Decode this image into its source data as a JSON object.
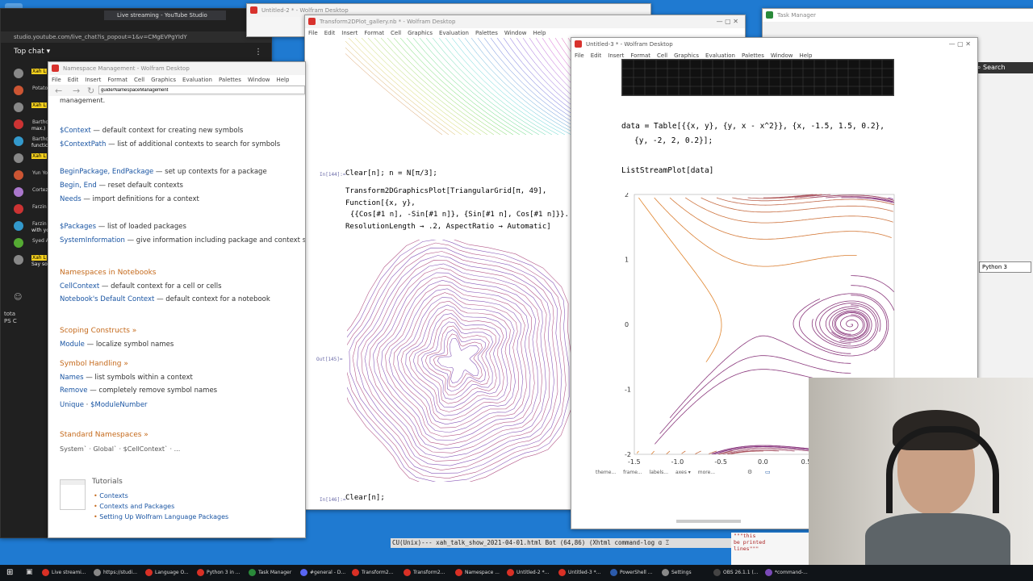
{
  "desktop": {
    "accent": "#1f7ad1"
  },
  "youtube": {
    "tab_title": "Live streaming - YouTube Studio",
    "url": "https://studio.youtube.com/live_chat?is_popout=1&v=CMgEVPgYIdY",
    "url_short": "studio.youtube.com/live_chat?is_popout=1&v=CMgEVPgYIdY",
    "top_chat": "Top chat",
    "chat": [
      {
        "name": "Xah L",
        "text": ""
      },
      {
        "name": "Potato",
        "text": ""
      },
      {
        "name": "Xah L",
        "text": ""
      },
      {
        "name": "Bartho",
        "text": "max.)"
      },
      {
        "name": "Bartho",
        "text": "functic"
      },
      {
        "name": "Xah L",
        "text": ""
      },
      {
        "name": "Yun Yo",
        "text": ""
      },
      {
        "name": "Cortez",
        "text": ""
      },
      {
        "name": "Farzin",
        "text": ""
      },
      {
        "name": "Farzin",
        "text": "with yc previo"
      },
      {
        "name": "Syed A",
        "text": ""
      },
      {
        "name": "Xah L",
        "text": "Say so"
      }
    ],
    "footer_text": "tota",
    "ps": "PS C"
  },
  "doc_window": {
    "title": "Namespace Management - Wolfram Desktop",
    "menu": [
      "File",
      "Edit",
      "Insert",
      "Format",
      "Cell",
      "Graphics",
      "Evaluation",
      "Palettes",
      "Window",
      "Help"
    ],
    "search_value": "guide/NamespaceManagement",
    "intro": "management.",
    "items": [
      {
        "link": "$Context",
        "desc": " — default context for creating new symbols"
      },
      {
        "link": "$ContextPath",
        "desc": " — list of additional contexts to search for symbols"
      },
      {
        "link": "BeginPackage, EndPackage",
        "desc": " — set up contexts for a package"
      },
      {
        "link": "Begin, End",
        "desc": " — reset default contexts"
      },
      {
        "link": "Needs",
        "desc": " — import definitions for a context"
      },
      {
        "link": "$Packages",
        "desc": " — list of loaded packages"
      },
      {
        "link": "SystemInformation",
        "desc": " — give information including package and context status"
      }
    ],
    "section_notebooks": "Namespaces in Notebooks",
    "nb_items": [
      {
        "link": "CellContext",
        "desc": " — default context for a cell or cells"
      },
      {
        "link": "Notebook's Default Context",
        "desc": " — default context for a notebook"
      }
    ],
    "section_scoping": "Scoping Constructs »",
    "scoping_item": {
      "link": "Module",
      "desc": " — localize symbol names"
    },
    "section_symbol": "Symbol Handling »",
    "symbol_items": [
      {
        "link": "Names",
        "desc": " — list symbols within a context"
      },
      {
        "link": "Remove",
        "desc": " — completely remove symbol names"
      }
    ],
    "unique": "Unique",
    "module_number": "$ModuleNumber",
    "section_standard": "Standard Namespaces »",
    "standard_line": "System` · Global` · $CellContext` · ...",
    "tutorials_head": "Tutorials",
    "tutorials": [
      "Contexts",
      "Contexts and Packages",
      "Setting Up Wolfram Language Packages"
    ]
  },
  "untitled2": {
    "title": "Untitled-2 * - Wolfram Desktop"
  },
  "gallery": {
    "title": "Transform2DPlot_gallery.nb * - Wolfram Desktop",
    "menu": [
      "File",
      "Edit",
      "Insert",
      "Format",
      "Cell",
      "Graphics",
      "Evaluation",
      "Palettes",
      "Window",
      "Help"
    ],
    "in144": "In[144]:=",
    "code1": "Clear[n]; n = N[π/3];",
    "code2": "Transform2DGraphicsPlot[TriangularGrid[π, 49],",
    "code3": " Function[{x, y},",
    "code4": "  {{Cos[#1 n], -Sin[#1 n]}, {Sin[#1 n], Cos[#1 n]}}.",
    "code5": " ResolutionLength → .2, AspectRatio → Automatic]",
    "out145": "Out[145]=",
    "in146": "In[146]:=",
    "code6": "Clear[n];"
  },
  "untitled3": {
    "title": "Untitled-3 * - Wolfram Desktop",
    "menu": [
      "File",
      "Edit",
      "Insert",
      "Format",
      "Cell",
      "Graphics",
      "Evaluation",
      "Palettes",
      "Window",
      "Help"
    ],
    "code1": "data = Table[{{x, y}, {y, x - x^2}}, {x, -1.5, 1.5, 0.2},",
    "code2": "{y, -2, 2, 0.2}];",
    "code3": "ListStreamPlot[data]",
    "toolbar": [
      "theme...",
      "frame...",
      "labels...",
      "axes ▾",
      "more..."
    ]
  },
  "chart_data": {
    "type": "streamplot",
    "x_ticks": [
      "-1.5",
      "-1.0",
      "-0.5",
      "0.0",
      "0.5"
    ],
    "y_ticks": [
      "2",
      "1",
      "0",
      "-1",
      "-2"
    ],
    "xlim": [
      -1.5,
      1.5
    ],
    "ylim": [
      -2,
      2
    ],
    "colors": {
      "left": "#e2862a",
      "right": "#7a2a8e"
    }
  },
  "task_manager": {
    "title": "Task Manager",
    "search": "Search",
    "python": "Python 3"
  },
  "emacs": {
    "status": "CU(Unix)---  xah_talk_show_2021-04-01.html   Bot (64,86)   (Xhtml command-log ɑ Ξ",
    "side_text": [
      "\"\"\"this",
      "be printed",
      "lines\"\"\""
    ]
  },
  "taskbar": {
    "items": [
      {
        "label": "Live streami...",
        "color": "#d93025"
      },
      {
        "label": "https://studi...",
        "color": "#888"
      },
      {
        "label": "Language O...",
        "color": "#d93025"
      },
      {
        "label": "Python 3 in ...",
        "color": "#d93025"
      },
      {
        "label": "Task Manager",
        "color": "#2a8a3a"
      },
      {
        "label": "#general - D...",
        "color": "#5865f2"
      },
      {
        "label": "Transform2...",
        "color": "#d93025"
      },
      {
        "label": "Transform2...",
        "color": "#d93025"
      },
      {
        "label": "Namespace ...",
        "color": "#d93025"
      },
      {
        "label": "Untitled-2 *...",
        "color": "#d93025"
      },
      {
        "label": "Untitled-3 *...",
        "color": "#d93025"
      },
      {
        "label": "PowerShell ...",
        "color": "#2c5bab"
      },
      {
        "label": "Settings",
        "color": "#888"
      },
      {
        "label": "OBS 26.1.1 (...",
        "color": "#444"
      },
      {
        "label": "*command-...",
        "color": "#7a4ab8"
      }
    ]
  }
}
